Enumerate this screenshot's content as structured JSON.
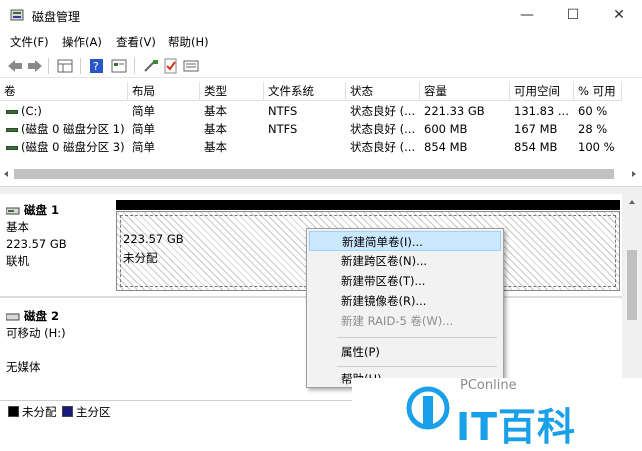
{
  "window": {
    "title": "磁盘管理",
    "minimize": "—",
    "maximize": "☐",
    "close": "✕"
  },
  "menu": [
    "文件(F)",
    "操作(A)",
    "查看(V)",
    "帮助(H)"
  ],
  "toolbar_icons": [
    "back-arrow-icon",
    "forward-arrow-icon",
    "grid-icon",
    "help-icon",
    "properties-icon",
    "connect-icon",
    "check-icon",
    "list-icon"
  ],
  "table": {
    "headers": [
      "卷",
      "布局",
      "类型",
      "文件系统",
      "状态",
      "容量",
      "可用空间",
      "% 可用"
    ],
    "rows": [
      [
        "(C:)",
        "简单",
        "基本",
        "NTFS",
        "状态良好 (...",
        "221.33 GB",
        "131.83 ...",
        "60 %"
      ],
      [
        "(磁盘 0 磁盘分区 1)",
        "简单",
        "基本",
        "NTFS",
        "状态良好 (...",
        "600 MB",
        "167 MB",
        "28 %"
      ],
      [
        "(磁盘 0 磁盘分区 3)",
        "简单",
        "基本",
        "",
        "状态良好 (...",
        "854 MB",
        "854 MB",
        "100 %"
      ]
    ]
  },
  "disks": [
    {
      "name": "磁盘 1",
      "type": "基本",
      "size": "223.57 GB",
      "status": "联机",
      "partition_size": "223.57 GB",
      "partition_status": "未分配"
    },
    {
      "name": "磁盘 2",
      "type": "可移动 (H:)",
      "status": "无媒体"
    }
  ],
  "context_menu": {
    "items": [
      {
        "label": "新建简单卷(I)...",
        "enabled": true,
        "highlighted": true
      },
      {
        "label": "新建跨区卷(N)...",
        "enabled": true
      },
      {
        "label": "新建带区卷(T)...",
        "enabled": true
      },
      {
        "label": "新建镜像卷(R)...",
        "enabled": true
      },
      {
        "label": "新建 RAID-5 卷(W)...",
        "enabled": false
      },
      {
        "label": "属性(P)",
        "enabled": true
      },
      {
        "label": "帮助(H)",
        "enabled": true
      }
    ]
  },
  "legend": [
    {
      "label": "未分配",
      "color": "#000000"
    },
    {
      "label": "主分区",
      "color": "#1a1a7a"
    }
  ],
  "watermark": {
    "small": "PConline",
    "big": "IT百科"
  },
  "colors": {
    "highlight": "#cce8ff",
    "highlight_border": "#99d1ff",
    "disabled": "#8c8c8c"
  }
}
